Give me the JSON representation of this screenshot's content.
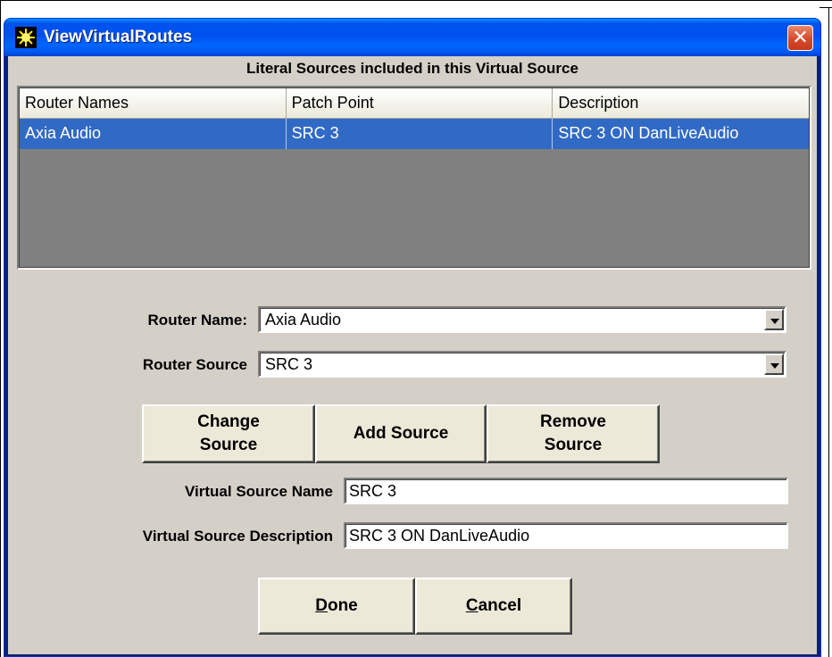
{
  "window": {
    "title": "ViewVirtualRoutes",
    "close_glyph": "✕"
  },
  "sources_group": {
    "title": "Literal Sources included in this Virtual Source",
    "columns": [
      "Router Names",
      "Patch Point",
      "Description"
    ],
    "rows": [
      {
        "router_name": "Axia Audio",
        "patch_point": "SRC 3",
        "description": "SRC 3 ON DanLiveAudio",
        "selected": true
      }
    ]
  },
  "router_name": {
    "label": "Router Name:",
    "value": "Axia Audio"
  },
  "router_source": {
    "label": "Router Source",
    "value": "SRC 3"
  },
  "buttons": {
    "change_source": "Change Source",
    "add_source": "Add Source",
    "remove_source": "Remove Source"
  },
  "virtual_source_name": {
    "label": "Virtual Source Name",
    "value": "SRC 3"
  },
  "virtual_source_description": {
    "label": "Virtual Source Description",
    "value": "SRC 3 ON DanLiveAudio"
  },
  "footer": {
    "done_label": "Done",
    "cancel_label": "Cancel"
  },
  "colors": {
    "titlebar": "#0054e3",
    "selection": "#316ac5",
    "dialog_bg": "#d4d0c8",
    "close_button": "#d9482a"
  },
  "icons": {
    "app_icon": "sunburst-icon",
    "close_icon": "close-icon",
    "dropdown_icon": "chevron-down-icon"
  }
}
